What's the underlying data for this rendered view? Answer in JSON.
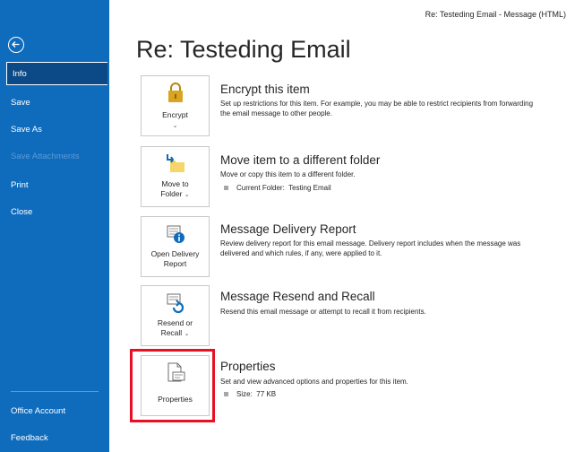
{
  "window": {
    "title": "Re: Testeding Email  -  Message (HTML)"
  },
  "page": {
    "title": "Re: Testeding Email"
  },
  "sidebar": {
    "back_icon": "back-arrow-icon",
    "items": [
      {
        "label": "Info",
        "state": "active"
      },
      {
        "label": "Save",
        "state": "normal"
      },
      {
        "label": "Save As",
        "state": "normal"
      },
      {
        "label": "Save Attachments",
        "state": "disabled"
      },
      {
        "label": "Print",
        "state": "normal"
      },
      {
        "label": "Close",
        "state": "normal"
      }
    ],
    "bottom_items": [
      {
        "label": "Office Account"
      },
      {
        "label": "Feedback"
      }
    ]
  },
  "sections": {
    "encrypt": {
      "tile_label": "Encrypt",
      "caret": "⌄",
      "title": "Encrypt this item",
      "description": "Set up restrictions for this item. For example, you may be able to restrict recipients from forwarding the email message to other people."
    },
    "move": {
      "tile_label_line1": "Move to",
      "tile_label_line2": "Folder",
      "caret": "⌄",
      "title": "Move item to a different folder",
      "description": "Move or copy this item to a different folder.",
      "meta_label": "Current Folder:",
      "meta_value": "Testing Email"
    },
    "delivery": {
      "tile_label_line1": "Open Delivery",
      "tile_label_line2": "Report",
      "title": "Message Delivery Report",
      "description": "Review delivery report for this email message. Delivery report includes when the message was delivered and which rules, if any, were applied to it."
    },
    "resend": {
      "tile_label_line1": "Resend or",
      "tile_label_line2": "Recall",
      "caret": "⌄",
      "title": "Message Resend and Recall",
      "description": "Resend this email message or attempt to recall it from recipients."
    },
    "properties": {
      "tile_label": "Properties",
      "title": "Properties",
      "description": "Set and view advanced options and properties for this item.",
      "meta_label": "Size:",
      "meta_value": "77 KB"
    }
  },
  "colors": {
    "sidebar_bg": "#0f6cbd",
    "sidebar_active": "#0b4a86",
    "highlight": "#e81123",
    "lock_gold": "#d9a520",
    "folder_yellow": "#f2c94c",
    "accent_blue": "#0f6cbd"
  }
}
